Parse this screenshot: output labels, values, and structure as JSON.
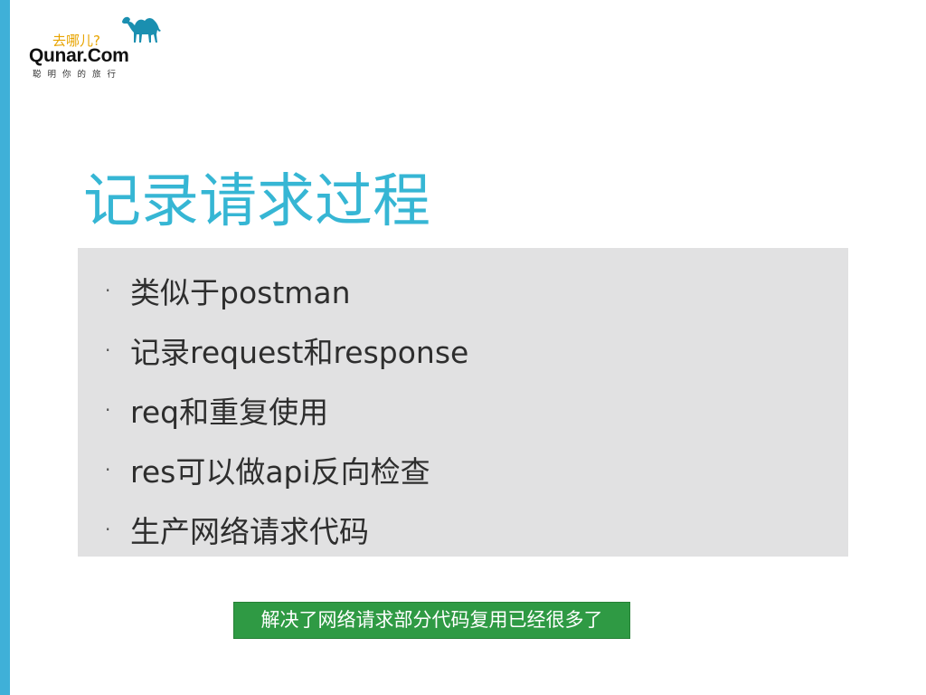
{
  "logo": {
    "tagline": "去哪儿?",
    "brand": "Qunar.Com",
    "slogan": "聪明你的旅行"
  },
  "slide": {
    "title": "记录请求过程",
    "bullets": [
      {
        "text": "类似于postman"
      },
      {
        "text": "记录request和response"
      },
      {
        "text": "req和重复使用"
      },
      {
        "text": "res可以做api反向检查"
      },
      {
        "text": "生产网络请求代码"
      }
    ],
    "note": "解决了网络请求部分代码复用已经很多了"
  },
  "colors": {
    "accent_bar": "#3fb0d8",
    "title": "#36b6d4",
    "content_bg": "#e1e1e2",
    "note_bg": "#2f9a44",
    "logo_tagline": "#e8a400",
    "camel": "#1a8fb0"
  }
}
